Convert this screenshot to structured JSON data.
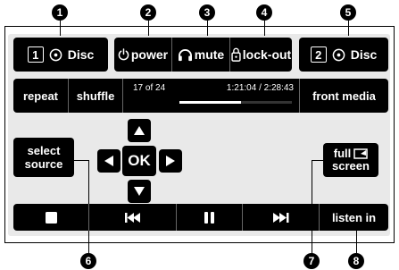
{
  "callouts": [
    "1",
    "2",
    "3",
    "4",
    "5",
    "6",
    "7",
    "8"
  ],
  "top_bar": {
    "disc1": {
      "number": "1",
      "label": "Disc",
      "icon": "disc-icon"
    },
    "power": {
      "label": "power",
      "icon": "power-icon"
    },
    "mute": {
      "label": "mute",
      "icon": "headphones-icon"
    },
    "lockout": {
      "label": "lock-out",
      "icon": "lock-icon"
    },
    "disc2": {
      "number": "2",
      "label": "Disc",
      "icon": "disc-icon"
    }
  },
  "media_bar": {
    "repeat": "repeat",
    "shuffle": "shuffle",
    "track": "17 of 24",
    "time": "1:21:04 / 2:28:43",
    "progress": 0.55,
    "front_media": "front media"
  },
  "controls": {
    "select_source_line1": "select",
    "select_source_line2": "source",
    "ok": "OK",
    "full_screen_line1": "full",
    "full_screen_line2": "screen"
  },
  "bottom_bar": {
    "stop_icon": "stop-icon",
    "prev_icon": "previous-track-icon",
    "pause_icon": "pause-icon",
    "next_icon": "next-track-icon",
    "listen_in": "listen in"
  }
}
